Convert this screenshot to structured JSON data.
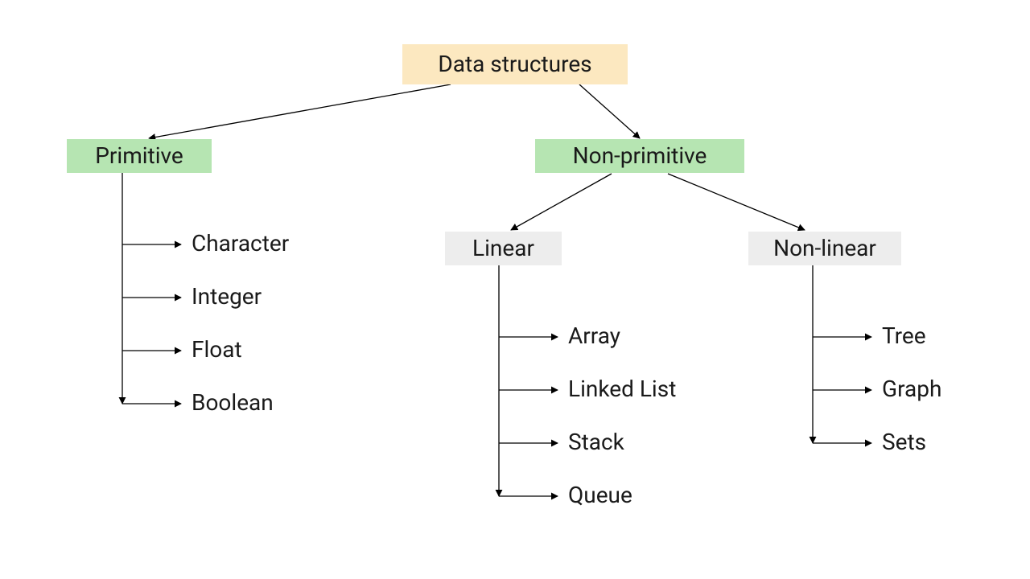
{
  "root": {
    "label": "Data structures"
  },
  "primitive": {
    "label": "Primitive",
    "items": [
      "Character",
      "Integer",
      "Float",
      "Boolean"
    ]
  },
  "nonprimitive": {
    "label": "Non-primitive",
    "linear": {
      "label": "Linear",
      "items": [
        "Array",
        "Linked List",
        "Stack",
        "Queue"
      ]
    },
    "nonlinear": {
      "label": "Non-linear",
      "items": [
        "Tree",
        "Graph",
        "Sets"
      ]
    }
  }
}
